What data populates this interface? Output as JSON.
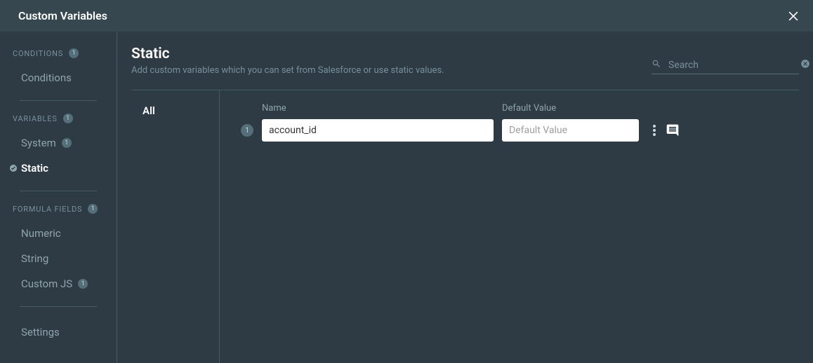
{
  "header": {
    "title": "Custom Variables"
  },
  "sidebar": {
    "sections": [
      {
        "label": "CONDITIONS",
        "badge": "1",
        "items": [
          {
            "label": "Conditions",
            "badge": null,
            "active": false
          }
        ]
      },
      {
        "label": "VARIABLES",
        "badge": "1",
        "items": [
          {
            "label": "System",
            "badge": "1",
            "active": false
          },
          {
            "label": "Static",
            "badge": null,
            "active": true
          }
        ]
      },
      {
        "label": "FORMULA FIELDS",
        "badge": "1",
        "items": [
          {
            "label": "Numeric",
            "badge": null,
            "active": false
          },
          {
            "label": "String",
            "badge": null,
            "active": false
          },
          {
            "label": "Custom JS",
            "badge": "1",
            "active": false
          }
        ]
      }
    ],
    "footer_item": {
      "label": "Settings"
    }
  },
  "main": {
    "title": "Static",
    "subtitle": "Add custom variables which you can set from Salesforce or use static values.",
    "search_placeholder": "Search",
    "filter": "All",
    "columns": {
      "name": "Name",
      "default": "Default Value"
    },
    "rows": [
      {
        "num": "1",
        "name": "account_id",
        "default": "",
        "default_placeholder": "Default Value"
      }
    ]
  }
}
